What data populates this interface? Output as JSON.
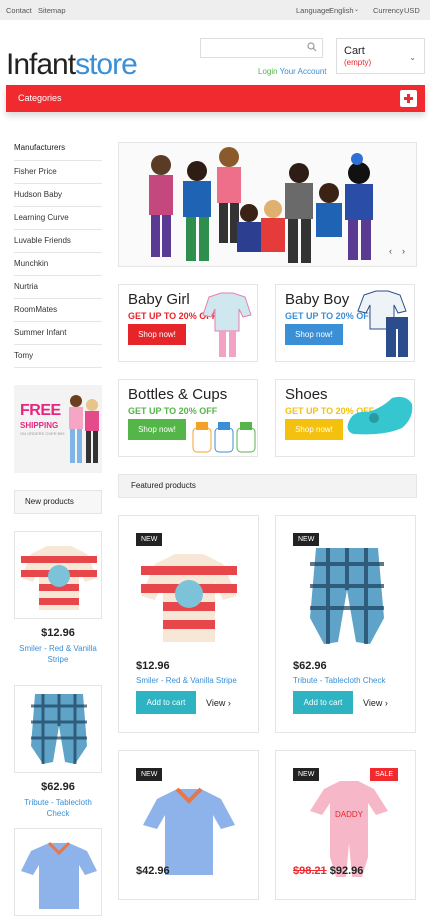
{
  "topbar": {
    "contact": "Contact",
    "sitemap": "Sitemap",
    "language_label": "Language:",
    "language_value": "English",
    "currency_label": "Currency",
    "currency_value": "USD"
  },
  "header": {
    "logo_part1": "Infant",
    "logo_part2": "store",
    "login": "Login",
    "your_account": "Your Account",
    "cart_title": "Cart",
    "cart_status": "(empty)"
  },
  "categories_label": "Categories",
  "sidebar": {
    "heading": "Manufacturers",
    "items": [
      "Fisher Price",
      "Hudson Baby",
      "Learning Curve",
      "Luvable Friends",
      "Munchkin",
      "Nurtria",
      "RoomMates",
      "Summer Infant",
      "Tomy"
    ],
    "promo": {
      "free": "FREE",
      "shipping": "SHIPPING",
      "sub": "ON ORDERS OVER $99"
    },
    "new_products_label": "New products",
    "new_products": [
      {
        "price": "$12.96",
        "name": "Smiler - Red & Vanilla Stripe"
      },
      {
        "price": "$62.96",
        "name": "Tribute - Tablecloth Check"
      }
    ]
  },
  "tiles": [
    {
      "title": "Baby Girl",
      "sub": "GET UP TO 20% OFF",
      "btn": "Shop now!",
      "color": "#e6252b",
      "btn_color": "#e6252b"
    },
    {
      "title": "Baby Boy",
      "sub": "GET UP TO 20% OFF",
      "btn": "Shop now!",
      "color": "#3a8fd6",
      "btn_color": "#3a8fd6"
    },
    {
      "title": "Bottles & Cups",
      "sub": "GET UP TO 20% OFF",
      "btn": "Shop now!",
      "color": "#54b548",
      "btn_color": "#54b548"
    },
    {
      "title": "Shoes",
      "sub": "GET UP TO 20% OFF",
      "btn": "Shop now!",
      "color": "#f4c10f",
      "btn_color": "#f4c10f"
    }
  ],
  "featured_label": "Featured products",
  "products": [
    {
      "badge": "NEW",
      "price": "$12.96",
      "name": "Smiler - Red & Vanilla Stripe",
      "add": "Add to cart",
      "view": "View"
    },
    {
      "badge": "NEW",
      "price": "$62.96",
      "name": "Tribute - Tablecloth Check",
      "add": "Add to cart",
      "view": "View"
    },
    {
      "badge": "NEW",
      "price": "$42.96",
      "name": ""
    },
    {
      "badge": "NEW",
      "sale": "SALE",
      "old_price": "$98.21",
      "price": "$92.96",
      "name": ""
    }
  ],
  "colors": {
    "accent_red": "#f02a2f",
    "accent_blue": "#3a8fd6",
    "accent_green": "#54b548",
    "accent_teal": "#2eb3c2"
  }
}
